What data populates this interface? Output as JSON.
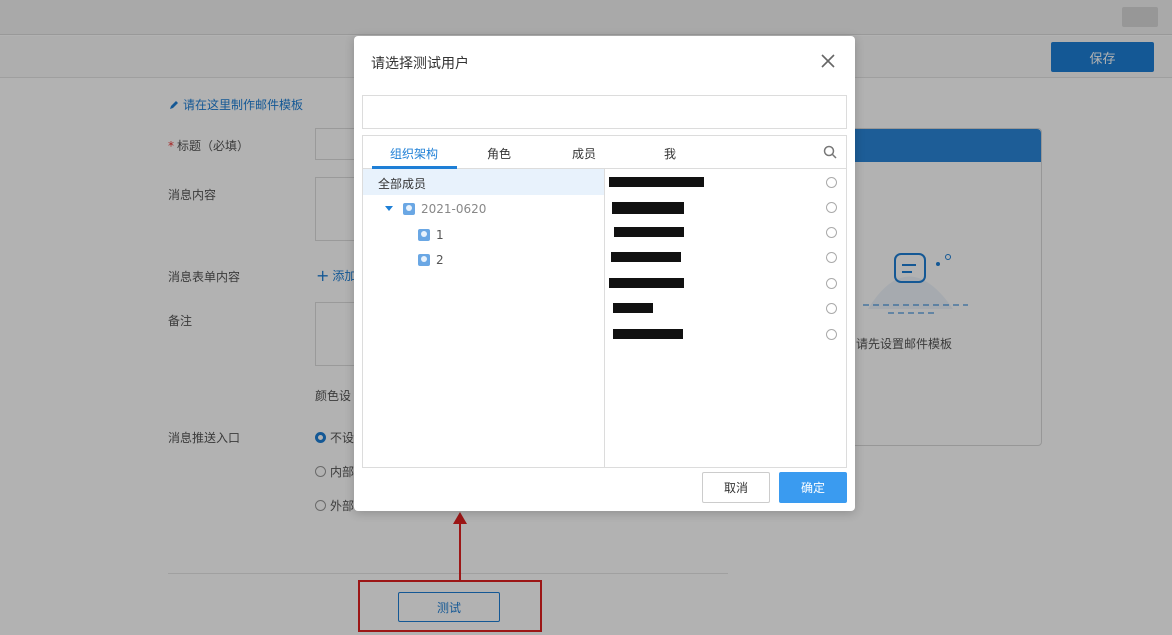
{
  "background": {
    "save_label": "保存",
    "template_hint": "请在这里制作邮件模板",
    "labels": {
      "title": "标题（必填）",
      "message_content": "消息内容",
      "form_content": "消息表单内容",
      "remark": "备注",
      "push_entry": "消息推送入口"
    },
    "add_label": "添加",
    "color_label": "颜色设",
    "radio_options": [
      "不设",
      "内部",
      "外部"
    ],
    "test_label": "测试",
    "preview_text": "请先设置邮件模板"
  },
  "dialog": {
    "title": "请选择测试用户",
    "tabs": [
      "组织架构",
      "角色",
      "成员",
      "我"
    ],
    "active_tab": 0,
    "all_members": "全部成员",
    "tree": {
      "root": "2021-0620",
      "children": [
        "1",
        "2"
      ]
    },
    "members_count_visible": 7,
    "cancel_label": "取消",
    "ok_label": "确定"
  },
  "colors": {
    "accent": "#1e7fd6",
    "ok_button": "#3a9bf0",
    "annotation": "#e02020"
  }
}
